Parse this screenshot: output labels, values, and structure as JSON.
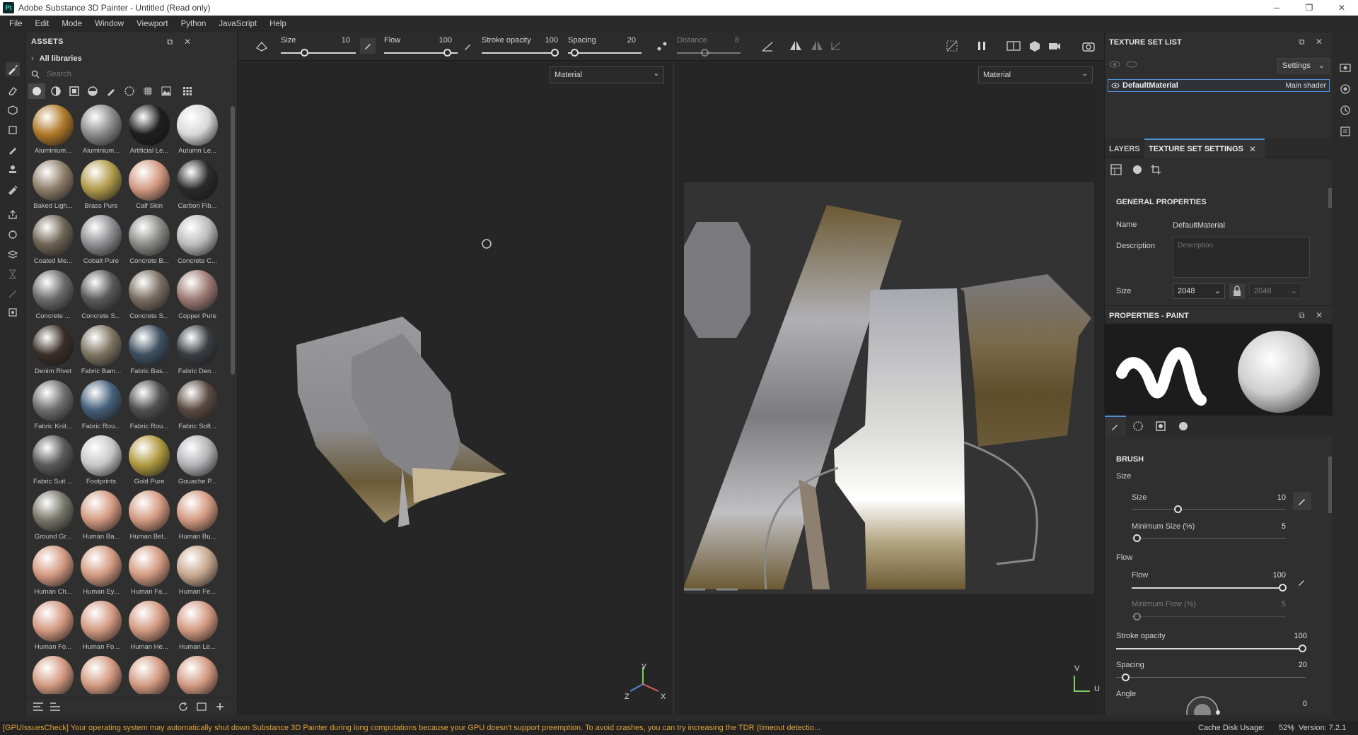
{
  "titlebar": {
    "logo": "Pt",
    "title": "Adobe Substance 3D Painter - Untitled (Read only)",
    "min": "─",
    "max": "❐",
    "close": "✕"
  },
  "menu": [
    "File",
    "Edit",
    "Mode",
    "Window",
    "Viewport",
    "Python",
    "JavaScript",
    "Help"
  ],
  "assets": {
    "title": "ASSETS",
    "library": "All libraries",
    "search_placeholder": "Search",
    "items": [
      {
        "name": "Aluminium...",
        "color": "#b07a2a"
      },
      {
        "name": "Aluminium...",
        "color": "#8c8c8c"
      },
      {
        "name": "Artificial Le...",
        "color": "#1e1e1e"
      },
      {
        "name": "Autumn Le...",
        "color": "#d9d9d9"
      },
      {
        "name": "Baked Ligh...",
        "color": "#8e7e6a"
      },
      {
        "name": "Brass Pure",
        "color": "#b09a4a"
      },
      {
        "name": "Calf Skin",
        "color": "#d49a82"
      },
      {
        "name": "Carbon Fib...",
        "color": "#2a2a2a"
      },
      {
        "name": "Coated Me...",
        "color": "#6e6454"
      },
      {
        "name": "Cobalt Pure",
        "color": "#8e8e90"
      },
      {
        "name": "Concrete B...",
        "color": "#8a8a86"
      },
      {
        "name": "Concrete C...",
        "color": "#bcbcbc"
      },
      {
        "name": "Concrete ...",
        "color": "#6a6a6a"
      },
      {
        "name": "Concrete S...",
        "color": "#5a5a5a"
      },
      {
        "name": "Concrete S...",
        "color": "#7a6e62"
      },
      {
        "name": "Copper Pure",
        "color": "#9e7a74"
      },
      {
        "name": "Denim Rivet",
        "color": "#3a2e28"
      },
      {
        "name": "Fabric Bam...",
        "color": "#7e7462"
      },
      {
        "name": "Fabric Bas...",
        "color": "#3e5060"
      },
      {
        "name": "Fabric Den...",
        "color": "#3a3e42"
      },
      {
        "name": "Fabric Knit...",
        "color": "#6e6e6e"
      },
      {
        "name": "Fabric Rou...",
        "color": "#46607a"
      },
      {
        "name": "Fabric Rou...",
        "color": "#505050"
      },
      {
        "name": "Fabric Soft...",
        "color": "#5a4a42"
      },
      {
        "name": "Fabric Suit ...",
        "color": "#5a5a5a"
      },
      {
        "name": "Footprints",
        "color": "#c8c8c8"
      },
      {
        "name": "Gold Pure",
        "color": "#b09a40"
      },
      {
        "name": "Gouache P...",
        "color": "#b4b4b8"
      },
      {
        "name": "Ground Gr...",
        "color": "#76766a"
      },
      {
        "name": "Human Ba...",
        "color": "#d49a82"
      },
      {
        "name": "Human Bel...",
        "color": "#d49a82"
      },
      {
        "name": "Human Bu...",
        "color": "#d49a82"
      },
      {
        "name": "Human Ch...",
        "color": "#d49a82"
      },
      {
        "name": "Human Ey...",
        "color": "#d49a82"
      },
      {
        "name": "Human Fa...",
        "color": "#d49a82"
      },
      {
        "name": "Human Fe...",
        "color": "#c8a890"
      },
      {
        "name": "Human Fo...",
        "color": "#d49a82"
      },
      {
        "name": "Human Fo...",
        "color": "#d49a82"
      },
      {
        "name": "Human He...",
        "color": "#d49a82"
      },
      {
        "name": "Human Le...",
        "color": "#d49a82"
      }
    ]
  },
  "toolbar": {
    "size_label": "Size",
    "size_value": "10",
    "flow_label": "Flow",
    "flow_value": "100",
    "stroke_label": "Stroke opacity",
    "stroke_value": "100",
    "spacing_label": "Spacing",
    "spacing_value": "20",
    "distance_label": "Distance",
    "distance_value": "8"
  },
  "viewports": {
    "left_channel": "Material",
    "right_channel": "Material",
    "axis_x": "X",
    "axis_y": "Y",
    "axis_z": "Z",
    "axis_u": "U",
    "axis_v": "V"
  },
  "texture_set_list": {
    "title": "TEXTURE SET LIST",
    "settings": "Settings",
    "material_name": "DefaultMaterial",
    "shader": "Main shader"
  },
  "tabs": {
    "layers": "LAYERS",
    "texture_set_settings": "TEXTURE SET SETTINGS"
  },
  "general_properties": {
    "title": "GENERAL PROPERTIES",
    "name_label": "Name",
    "name_value": "DefaultMaterial",
    "description_label": "Description",
    "description_placeholder": "Description",
    "size_label": "Size",
    "size_value": "2048",
    "size_value_2": "2048"
  },
  "properties_paint": {
    "title": "PROPERTIES - PAINT",
    "brush_title": "BRUSH",
    "size_group": "Size",
    "size_label": "Size",
    "size_value": "10",
    "min_size_label": "Minimum Size (%)",
    "min_size_value": "5",
    "flow_group": "Flow",
    "flow_label": "Flow",
    "flow_value": "100",
    "min_flow_label": "Minimum Flow (%)",
    "min_flow_value": "5",
    "stroke_label": "Stroke opacity",
    "stroke_value": "100",
    "spacing_label": "Spacing",
    "spacing_value": "20",
    "angle_label": "Angle",
    "angle_value": "0"
  },
  "status": {
    "warning": "[GPUIssuesCheck] Your operating system may automatically shut down Substance 3D Painter during long computations because your GPU doesn't support preemption. To avoid crashes, you can try increasing the TDR (timeout detectio...",
    "cache": "Cache Disk Usage:",
    "cache_value": "52%",
    "version": "Version: 7.2.1"
  }
}
